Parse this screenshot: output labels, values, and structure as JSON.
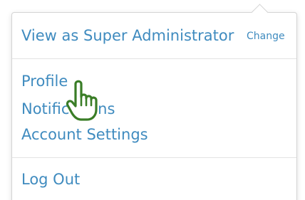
{
  "user_menu": {
    "view_as": {
      "label": "View as Super Administrator",
      "change_label": "Change"
    },
    "items": [
      {
        "label": "Profile"
      },
      {
        "label": "Notifications"
      },
      {
        "label": "Account Settings"
      }
    ],
    "logout_label": "Log Out"
  },
  "colors": {
    "link": "#3f8bbf",
    "border": "#d4d4d4",
    "divider": "#e3e3e3",
    "cursor_outline": "#3a7d27"
  },
  "cursor": {
    "icon": "hand-pointer-icon"
  }
}
